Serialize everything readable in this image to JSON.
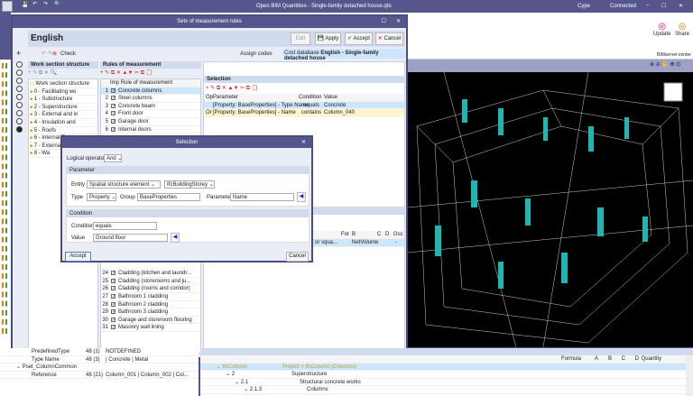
{
  "app": {
    "title": "Open BIM Quantities - Single-family detached house.qto",
    "status_user": "Cype",
    "status_conn": "Connected",
    "update": "Update",
    "share": "Share",
    "group": "BIMserver.center"
  },
  "dialog": {
    "title": "Sets of measurement rules",
    "name": "English",
    "edit": "Edit",
    "apply": "Apply",
    "accept": "Accept",
    "cancel": "Cancel",
    "check": "Check",
    "assign_codes": "Assign codes",
    "cost_db_label": "Cost database",
    "cost_db_value": "English - Single-family detached house"
  },
  "wss": {
    "header": "Work section structure",
    "root": "Work section structure",
    "items": [
      "0 - Facilitating wo",
      "1 - Substructure",
      "2 - Superstructure",
      "3 - External and in",
      "4 - Insulation and",
      "5 - Roofs",
      "6 - Internal Finishe",
      "7 - External work",
      "8 - Wa"
    ]
  },
  "rules": {
    "header": "Rules of measurement",
    "col_imp": "Imp",
    "col_rule": "Rule of measurement",
    "top": [
      [
        "1",
        "Concrete columns"
      ],
      [
        "2",
        "Steel columns"
      ],
      [
        "3",
        "Concrete beam"
      ],
      [
        "4",
        "Front door"
      ],
      [
        "5",
        "Garage door"
      ],
      [
        "6",
        "Internal doors"
      ]
    ],
    "bottom": [
      [
        "24",
        "Cladding (kitchen and laundr..."
      ],
      [
        "25",
        "Cladding (storerooms and ju..."
      ],
      [
        "26",
        "Cladding (rooms and corridor)"
      ],
      [
        "27",
        "Bathroom 1 cladding"
      ],
      [
        "28",
        "Bathroom 2 cladding"
      ],
      [
        "29",
        "Bathroom 3 cladding"
      ],
      [
        "30",
        "Garage and storeroom flooring"
      ],
      [
        "31",
        "Masonry wall lining"
      ]
    ]
  },
  "selection": {
    "header": "Selection",
    "cols": [
      "Op",
      "Parameter",
      "Condition",
      "Value"
    ],
    "rows": [
      [
        "",
        "[Property: BaseProperties] - Type Name",
        "equals",
        "Concrete"
      ],
      [
        "Or",
        "[Property: BaseProperties] - Name",
        "contains",
        "Column_040"
      ]
    ]
  },
  "measure": {
    "cols": [
      "For",
      "B",
      "C",
      "D",
      "Gsc"
    ],
    "row": [
      "or squa...",
      "",
      "NetVolume",
      "",
      "",
      "-"
    ]
  },
  "sdialog": {
    "title": "Selection",
    "logical_label": "Logical operator",
    "logical_value": "And",
    "param_header": "Parameter",
    "entity_label": "Entity",
    "entity_value": "Spatial structure element",
    "entity_type": "IfcBuildingStorey",
    "type_label": "Type",
    "type_value": "Property",
    "group_label": "Group",
    "group_value": "BaseProperties",
    "parameter_label": "Parameter",
    "parameter_value": "Name",
    "cond_header": "Condition",
    "condition_label": "Condition",
    "condition_value": "equals",
    "value_label": "Value",
    "value_value": "Ground floor",
    "accept": "Accept",
    "cancel": "Cancel"
  },
  "props": {
    "rows": [
      [
        "PredefinedType",
        "48 (1)",
        "NOTDEFINED"
      ],
      [
        "Type Name",
        "48 (3)",
        "| Concrete | Metal"
      ],
      [
        "Pset_ColumnCommon",
        "",
        ""
      ],
      [
        "Reference",
        "48 (21)",
        "Column_001 | Column_002 | Col..."
      ]
    ]
  },
  "tree": {
    "cols": [
      "Formula",
      "A",
      "B",
      "C",
      "D",
      "Quantity"
    ],
    "rows": [
      [
        "IfcColumn",
        "Project > IfcColumn (Columns)"
      ],
      [
        "2",
        "Superstructure"
      ],
      [
        "2.1",
        "Structural concrete works"
      ],
      [
        "2.1.3",
        "Columns"
      ]
    ]
  },
  "colors": {
    "frame": "#55578c",
    "header": "#d0dbee",
    "selected": "#cde6fb",
    "highlight": "#fff4cc",
    "element": "#1fb5b0"
  }
}
